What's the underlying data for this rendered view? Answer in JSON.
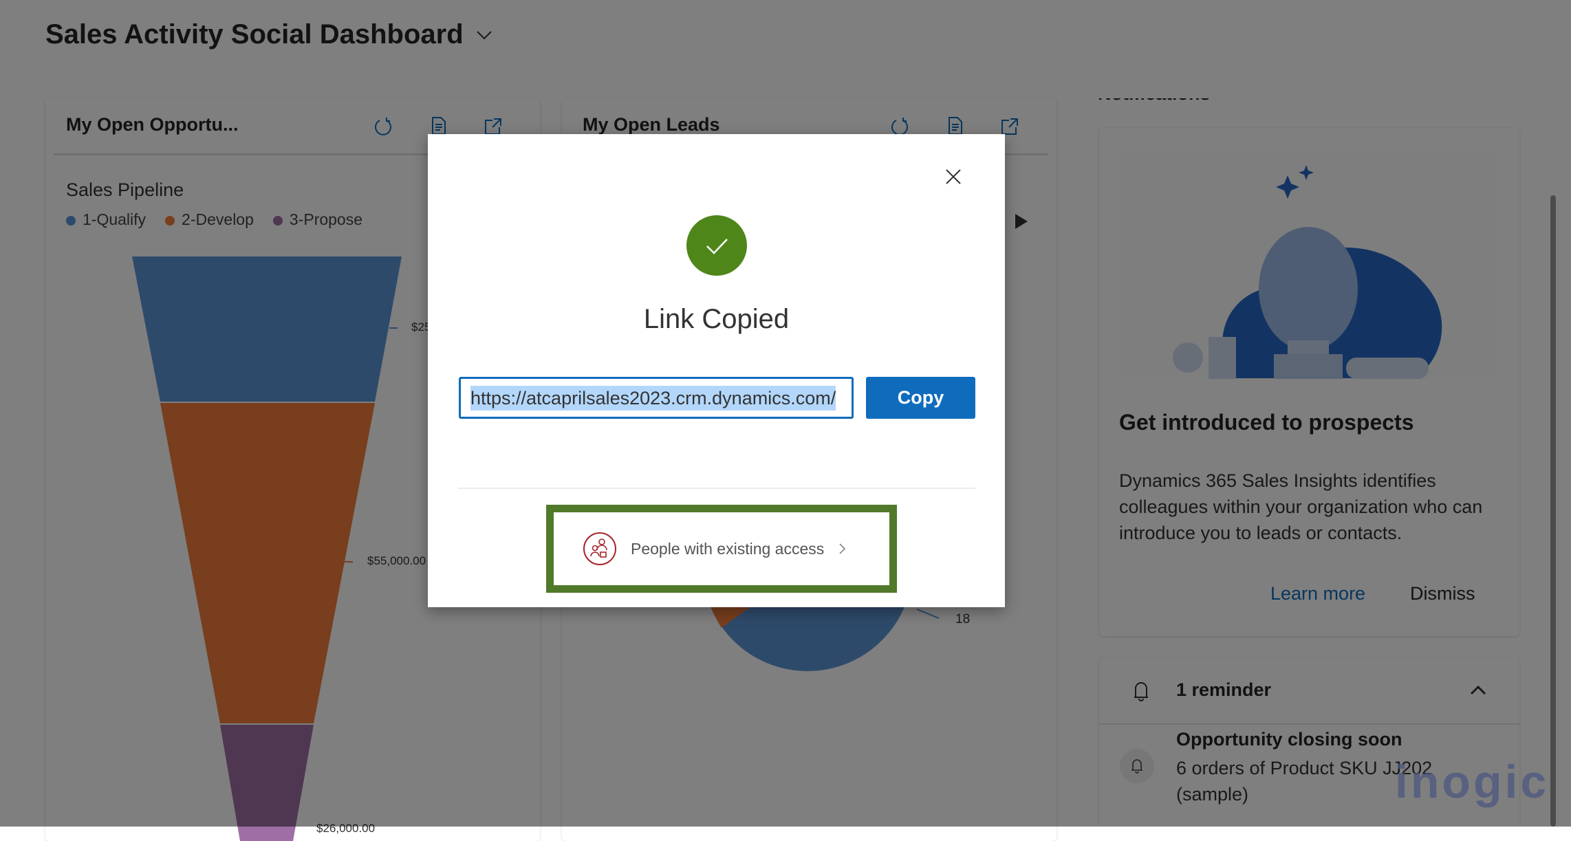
{
  "dashboard": {
    "title": "Sales Activity Social Dashboard"
  },
  "cards": [
    {
      "title": "My Open Opportu...",
      "chart_title": "Sales Pipeline",
      "legend": [
        {
          "label": "1-Qualify",
          "color": "#5c94d6"
        },
        {
          "label": "2-Develop",
          "color": "#f07c3a"
        },
        {
          "label": "3-Propose",
          "color": "#9e6ea4"
        }
      ],
      "labels": [
        "$25",
        "$55,000.00",
        "$26,000.00"
      ]
    },
    {
      "title": "My Open Leads",
      "pie_label": "18"
    }
  ],
  "notifications": {
    "heading": "Notifications",
    "promo": {
      "title": "Get introduced to prospects",
      "body": "Dynamics 365 Sales Insights identifies colleagues within your organization who can introduce you to leads or contacts.",
      "learn_more": "Learn more",
      "dismiss": "Dismiss"
    },
    "reminders": {
      "count_label": "1 reminder",
      "item_title": "Opportunity closing soon",
      "item_body": "6 orders of Product SKU JJ202 (sample)"
    }
  },
  "modal": {
    "title": "Link Copied",
    "url": "https://atcaprilsales2023.crm.dynamics.com/",
    "copy_label": "Copy",
    "access_label": "People with existing access",
    "accent": "#0f6cbd",
    "success_color": "#4e861a",
    "highlight_color": "#507a2a"
  },
  "watermark": "inogic"
}
